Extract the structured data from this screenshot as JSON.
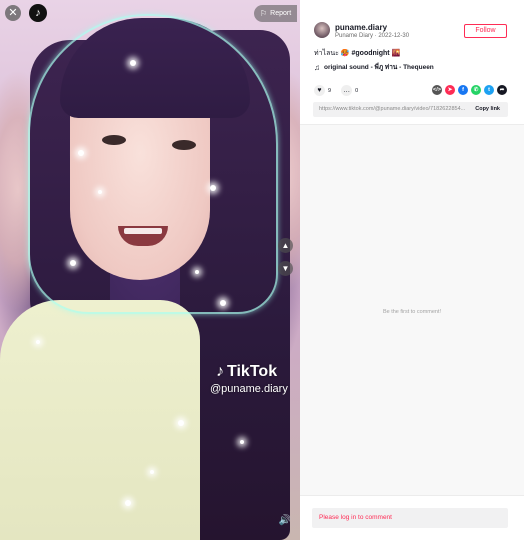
{
  "video": {
    "report_label": "Report",
    "watermark": {
      "brand": "TikTok",
      "handle": "@puname.diary"
    }
  },
  "author": {
    "username": "puname.diary",
    "display_line": "Puname Diary · 2022-12-30",
    "follow_label": "Follow"
  },
  "caption": {
    "text": "ท่าไลนะ 🥵",
    "hashtag": "#goodnight",
    "emoji": "🌇"
  },
  "music": {
    "label": "original sound - พี่ภู ท่าน - Thequeen"
  },
  "stats": {
    "likes": "9",
    "comments": "0"
  },
  "share": {
    "icons": [
      "embed-icon",
      "send-icon",
      "facebook-icon",
      "whatsapp-icon",
      "twitter-icon",
      "share-arrow-icon"
    ],
    "colors": {
      "embed": "#555555",
      "send": "#fe2c55",
      "facebook": "#1877f2",
      "whatsapp": "#25d366",
      "twitter": "#1da1f2",
      "more": "#161823"
    }
  },
  "link": {
    "url": "https://www.tiktok.com/@puname.diary/video/7182622854...",
    "copy_label": "Copy link"
  },
  "comments": {
    "empty_text": "Be the first to comment!"
  },
  "login": {
    "prompt": "Please log in to comment"
  },
  "colors": {
    "accent": "#fe2c55",
    "text": "#161823"
  }
}
